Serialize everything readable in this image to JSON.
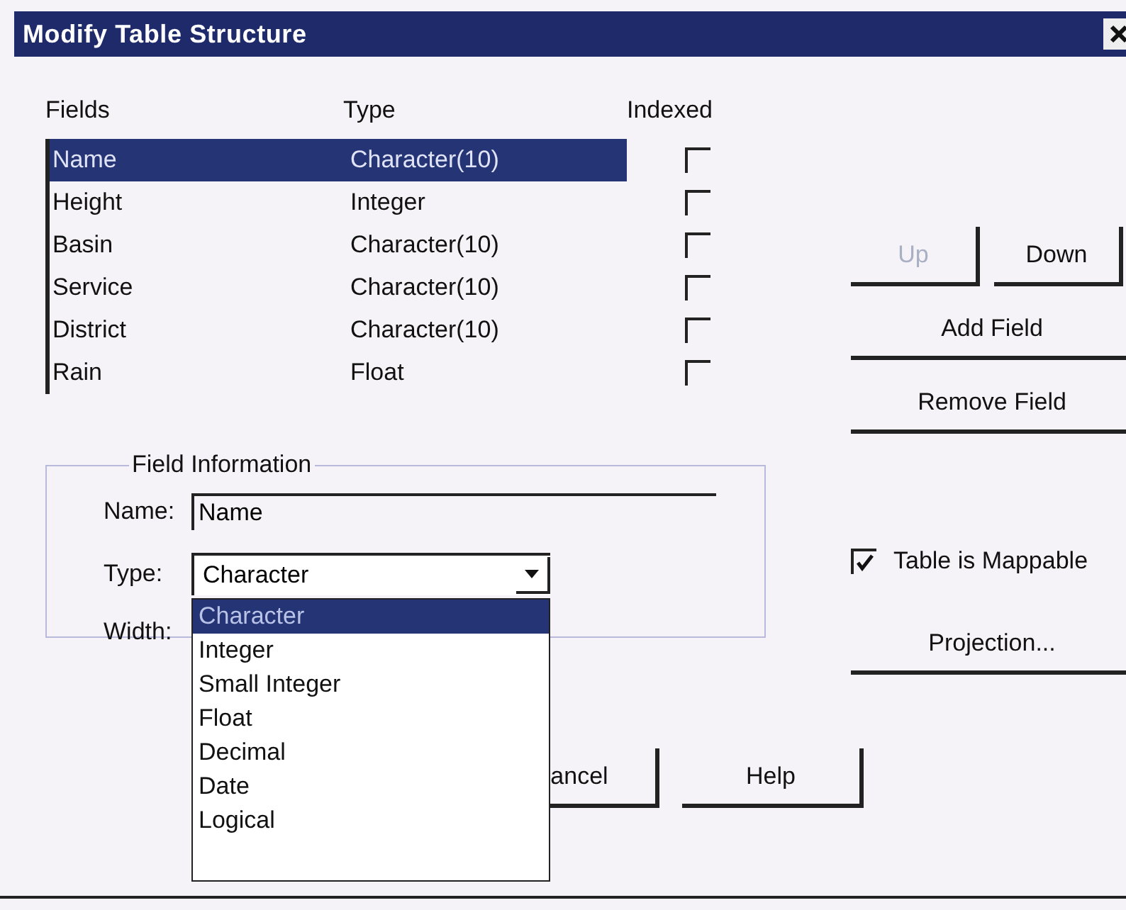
{
  "window": {
    "title": "Modify Table Structure"
  },
  "fields_table": {
    "columns": [
      "Fields",
      "Type",
      "Indexed"
    ],
    "rows": [
      {
        "name": "Name",
        "type": "Character(10)",
        "indexed": false,
        "selected": true
      },
      {
        "name": "Height",
        "type": "Integer",
        "indexed": false,
        "selected": false
      },
      {
        "name": "Basin",
        "type": "Character(10)",
        "indexed": false,
        "selected": false
      },
      {
        "name": "Service",
        "type": "Character(10)",
        "indexed": false,
        "selected": false
      },
      {
        "name": "District",
        "type": "Character(10)",
        "indexed": false,
        "selected": false
      },
      {
        "name": "Rain",
        "type": "Float",
        "indexed": false,
        "selected": false
      }
    ]
  },
  "side_buttons": [
    {
      "label": "Up",
      "disabled": true,
      "kind": "half"
    },
    {
      "label": "Down",
      "disabled": false,
      "kind": "half"
    },
    {
      "label": "Add Field",
      "disabled": false,
      "kind": "full"
    },
    {
      "label": "Remove Field",
      "disabled": false,
      "kind": "full"
    }
  ],
  "field_information": {
    "title": "Field Information",
    "name_label": "Name:",
    "name_value": "Name",
    "type_label": "Type:",
    "type_value": "Character",
    "width_label": "Width:",
    "type_dropdown_open": true,
    "type_options": [
      {
        "label": "Character",
        "selected": true
      },
      {
        "label": "Integer",
        "selected": false
      },
      {
        "label": "Small Integer",
        "selected": false
      },
      {
        "label": "Float",
        "selected": false
      },
      {
        "label": "Decimal",
        "selected": false
      },
      {
        "label": "Date",
        "selected": false
      },
      {
        "label": "Logical",
        "selected": false
      }
    ]
  },
  "table_is_mappable": {
    "label": "Table is Mappable",
    "checked": true
  },
  "projection_button": "Projection...",
  "bottom_buttons": [
    "ancel",
    "Help"
  ]
}
